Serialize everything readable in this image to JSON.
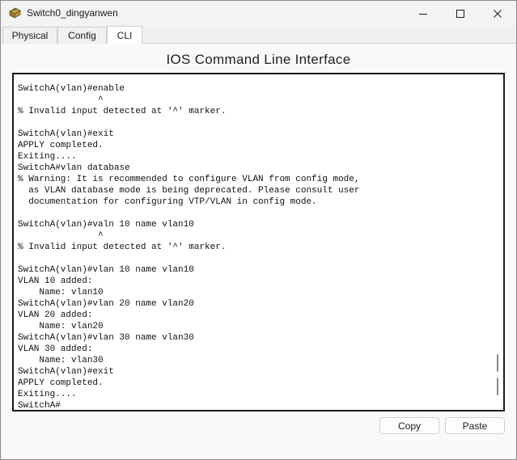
{
  "window": {
    "title": "Switch0_dingyanwen"
  },
  "tabs": [
    {
      "label": "Physical"
    },
    {
      "label": "Config"
    },
    {
      "label": "CLI"
    }
  ],
  "heading": "IOS Command Line Interface",
  "terminal": {
    "text": "SwitchA(vlan)#enable\n               ^\n% Invalid input detected at '^' marker.\n\nSwitchA(vlan)#exit\nAPPLY completed.\nExiting....\nSwitchA#vlan database\n% Warning: It is recommended to configure VLAN from config mode,\n  as VLAN database mode is being deprecated. Please consult user\n  documentation for configuring VTP/VLAN in config mode.\n\nSwitchA(vlan)#valn 10 name vlan10\n               ^\n% Invalid input detected at '^' marker.\n\nSwitchA(vlan)#vlan 10 name vlan10\nVLAN 10 added:\n    Name: vlan10\nSwitchA(vlan)#vlan 20 name vlan20\nVLAN 20 added:\n    Name: vlan20\nSwitchA(vlan)#vlan 30 name vlan30\nVLAN 30 added:\n    Name: vlan30\nSwitchA(vlan)#exit\nAPPLY completed.\nExiting....\nSwitchA#"
  },
  "buttons": {
    "copy": "Copy",
    "paste": "Paste"
  },
  "icons": {
    "app": "switch-icon",
    "minimize": "minimize-icon",
    "maximize": "maximize-icon",
    "close": "close-icon"
  }
}
